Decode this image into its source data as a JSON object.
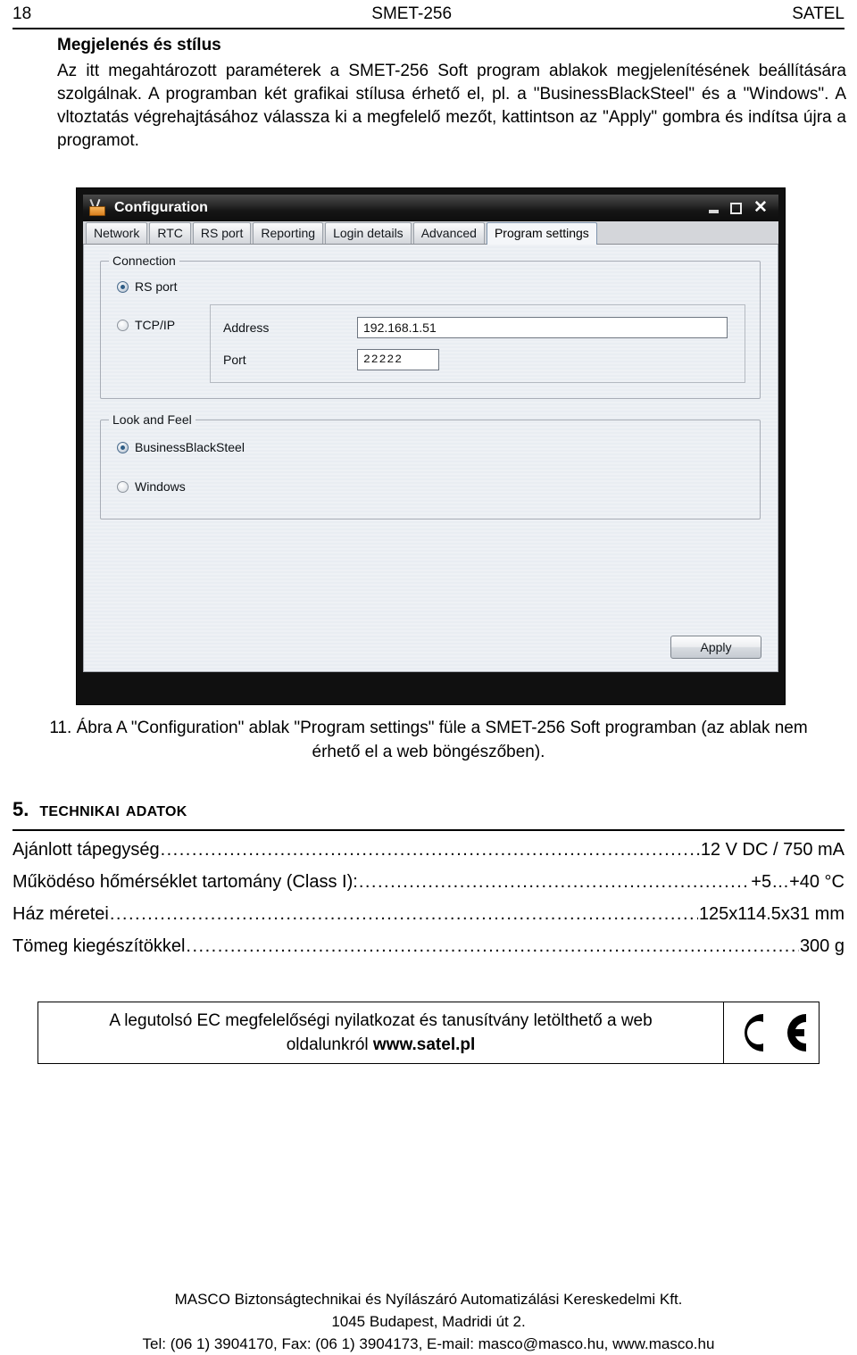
{
  "page_header": {
    "page_number": "18",
    "document_title": "SMET-256",
    "brand": "SATEL"
  },
  "intro": {
    "heading": "Megjelenés és stílus",
    "paragraph": "Az itt megahtározott paraméterek a SMET-256 Soft program ablakok megjelenítésének beállítására szolgálnak. A programban két grafikai stílusa érhető el, pl. a \"BusinessBlackSteel\" és a \"Windows\". A vltoztatás végrehajtásához válassza ki a megfelelő mezőt, kattintson az \"Apply\" gombra és indítsa újra a programot."
  },
  "app_window": {
    "title": "Configuration",
    "icon": "toolbox-icon",
    "window_buttons": {
      "minimize": "minimize-icon",
      "maximize": "maximize-icon",
      "close": "✕"
    },
    "tabs": [
      {
        "label": "Network",
        "active": false
      },
      {
        "label": "RTC",
        "active": false
      },
      {
        "label": "RS port",
        "active": false
      },
      {
        "label": "Reporting",
        "active": false
      },
      {
        "label": "Login details",
        "active": false
      },
      {
        "label": "Advanced",
        "active": false
      },
      {
        "label": "Program settings",
        "active": true
      }
    ],
    "connection_group": {
      "title": "Connection",
      "options": [
        {
          "label": "RS port",
          "selected": true
        },
        {
          "label": "TCP/IP",
          "selected": false
        }
      ],
      "fields": [
        {
          "label": "Address",
          "value": "192.168.1.51"
        },
        {
          "label": "Port",
          "value": "22222"
        }
      ]
    },
    "look_and_feel_group": {
      "title": "Look and Feel",
      "options": [
        {
          "label": "BusinessBlackSteel",
          "selected": true
        },
        {
          "label": "Windows",
          "selected": false
        }
      ]
    },
    "apply_button": "Apply",
    "accent_color": "#2f5d86",
    "titlebar_color": "#161616"
  },
  "figure_caption": {
    "line1": "11. Ábra A \"Configuration\" ablak \"Program settings\" füle a SMET-256 Soft programban (az",
    "line2": "ablak nem érhető el a web böngészőben)."
  },
  "section": {
    "number": "5.",
    "title": "Technikai adatok"
  },
  "specs": [
    {
      "name": "Ajánlott tápegység",
      "value": "12 V DC / 750 mA"
    },
    {
      "name": "Működéso hőmérséklet tartomány (Class I):",
      "value": "+5…+40 °C"
    },
    {
      "name": "Ház méretei",
      "value": "125x114.5x31 mm"
    },
    {
      "name": "Tömeg kiegészítökkel",
      "value": "300 g"
    }
  ],
  "ce_notice": {
    "text_line1": "A legutolsó EC megfelelőségi nyilatkozat és tanusítvány letölthető a web",
    "text_line2_prefix": "oldalunkról ",
    "text_line2_bold": "www.satel.pl",
    "mark": "CE"
  },
  "footer": {
    "line1": "MASCO Biztonságtechnikai és Nyílászáró Automatizálási Kereskedelmi Kft.",
    "line2": "1045 Budapest, Madridi út 2.",
    "line3": "Tel: (06 1) 3904170, Fax: (06 1) 3904173, E-mail: masco@masco.hu, www.masco.hu"
  }
}
